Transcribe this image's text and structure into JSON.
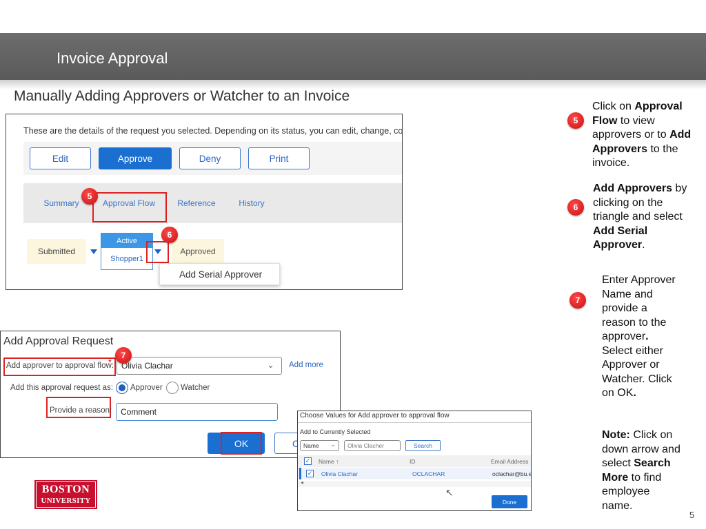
{
  "header": {
    "title": "Invoice Approval"
  },
  "subtitle": "Manually Adding Approvers or Watcher to an Invoice",
  "request_panel": {
    "intro_text": "These are the details of the request you selected. Depending on its status, you can edit, change, copy, can",
    "buttons": {
      "edit": "Edit",
      "approve": "Approve",
      "deny": "Deny",
      "print": "Print"
    },
    "tabs": {
      "summary": "Summary",
      "approval_flow": "Approval Flow",
      "reference": "Reference",
      "history": "History"
    },
    "flow": {
      "submitted": "Submitted",
      "active_label": "Active",
      "active_user": "Shopper1",
      "approved": "Approved"
    },
    "menu_item": "Add Serial Approver"
  },
  "markers": {
    "m5": "5",
    "m6": "6",
    "m7": "7"
  },
  "add_approval_dialog": {
    "title": "Add Approval Request",
    "approver_label": "Add approver to approval flow:",
    "required_star": "*",
    "approver_value": "Olivia Clachar",
    "add_more": "Add more",
    "request_as_label": "Add this approval request as:",
    "option_approver": "Approver",
    "option_watcher": "Watcher",
    "reason_label": "Provide a reason:",
    "reason_value": "Comment",
    "ok": "OK",
    "cancel_partial": "C"
  },
  "chooser_dialog": {
    "title": "Choose Values for Add approver to approval flow",
    "add_to_selected": "Add to Currently Selected",
    "filter_field": "Name",
    "search_value": "Olivia Clacher",
    "search_button": "Search",
    "columns": {
      "name": "Name ↑",
      "id": "ID",
      "email": "Email Address"
    },
    "row": {
      "name": "Olivia Clachar",
      "id": "OCLACHAR",
      "email": "oclachar@bu.edu"
    },
    "scroll_left": "◂",
    "done": "Done"
  },
  "instructions": {
    "step5": {
      "a": "Click on ",
      "b": "Approval Flow",
      "c": " to view approvers or to ",
      "d": "Add Approvers",
      "e": " to the invoice."
    },
    "step6": {
      "a": "Add Approvers",
      "b": " by clicking on the triangle and select ",
      "c": "Add Serial Approver",
      "d": "."
    },
    "step7": {
      "a": "Enter Approver Name and provide a reason to the approver",
      "b": ".",
      "c": " Select either Approver or Watcher. Click on OK",
      "d": "."
    },
    "note": {
      "a": "Note:",
      "b": " Click on down arrow and select ",
      "c": "Search More",
      "d": " to find employee name."
    }
  },
  "logo": {
    "line1": "BOSTON",
    "line2": "UNIVERSITY"
  },
  "page_number": "5",
  "colors": {
    "header_bg": "#5f5f5f",
    "accent_blue": "#1a6fd1",
    "marker_red": "#d81b1b",
    "highlight_red": "#e02020",
    "bu_red": "#c8102e"
  }
}
